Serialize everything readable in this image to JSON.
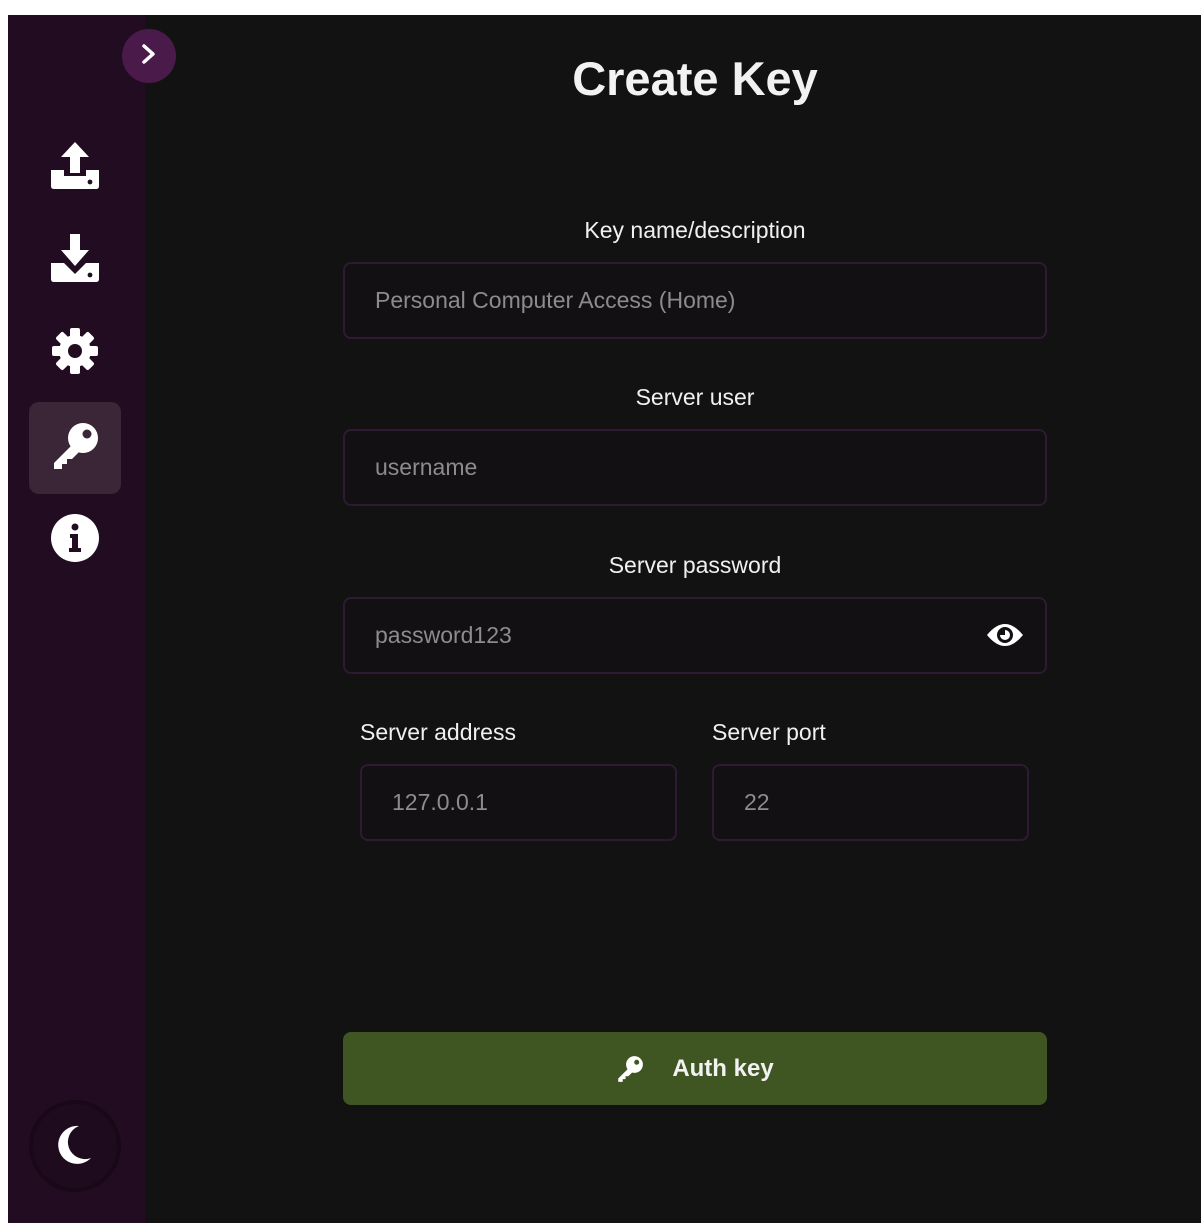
{
  "sidebar": {
    "expand_icon": "chevron-right-icon",
    "items": [
      {
        "icon": "upload-icon",
        "active": false
      },
      {
        "icon": "download-icon",
        "active": false
      },
      {
        "icon": "gear-icon",
        "active": false
      },
      {
        "icon": "key-icon",
        "active": true
      },
      {
        "icon": "info-icon",
        "active": false
      }
    ],
    "theme_icon": "moon-icon"
  },
  "page": {
    "title": "Create Key"
  },
  "form": {
    "key_name": {
      "label": "Key name/description",
      "placeholder": "Personal Computer Access (Home)",
      "value": ""
    },
    "server_user": {
      "label": "Server user",
      "placeholder": "username",
      "value": ""
    },
    "server_password": {
      "label": "Server password",
      "placeholder": "password123",
      "value": "",
      "toggle_icon": "eye-icon"
    },
    "server_address": {
      "label": "Server address",
      "placeholder": "127.0.0.1",
      "value": ""
    },
    "server_port": {
      "label": "Server port",
      "placeholder": "22",
      "value": ""
    }
  },
  "submit": {
    "label": "Auth key",
    "icon": "key-icon"
  },
  "colors": {
    "sidebar_bg": "#220c22",
    "main_bg": "#121212",
    "accent_purple": "#4a1a4a",
    "button_green": "#3f5623",
    "field_border": "#2f1a33"
  }
}
